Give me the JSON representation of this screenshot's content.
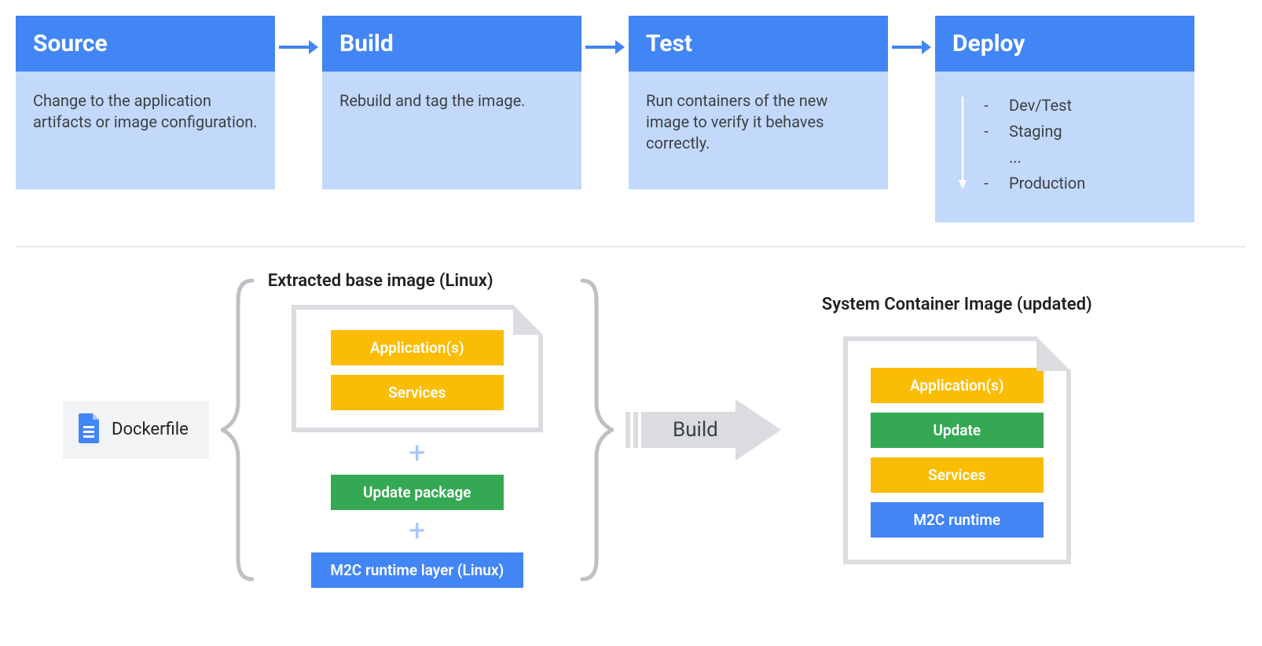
{
  "pipeline": {
    "stages": [
      {
        "title": "Source",
        "body": "Change to the application artifacts or image configuration."
      },
      {
        "title": "Build",
        "body": "Rebuild and tag the image."
      },
      {
        "title": "Test",
        "body": "Run containers of the new image to verify it behaves correctly."
      },
      {
        "title": "Deploy",
        "body": ""
      }
    ],
    "deploy_items": [
      "Dev/Test",
      "Staging",
      "...",
      "Production"
    ]
  },
  "colors": {
    "primary_blue": "#4285f4",
    "light_blue": "#c3d9fb",
    "yellow": "#fbbc04",
    "green": "#34a853",
    "grey": "#dadce0"
  },
  "lower": {
    "dockerfile_label": "Dockerfile",
    "left_stack_title": "Extracted base image (Linux)",
    "left_doc_bars": [
      "Application(s)",
      "Services"
    ],
    "update_bar": "Update package",
    "runtime_bar": "M2C runtime layer (Linux)",
    "build_arrow_label": "Build",
    "right_title": "System Container Image (updated)",
    "right_bars": [
      {
        "text": "Application(s)",
        "color": "yellow"
      },
      {
        "text": "Update",
        "color": "green"
      },
      {
        "text": "Services",
        "color": "yellow"
      },
      {
        "text": "M2C runtime",
        "color": "blue"
      }
    ]
  }
}
